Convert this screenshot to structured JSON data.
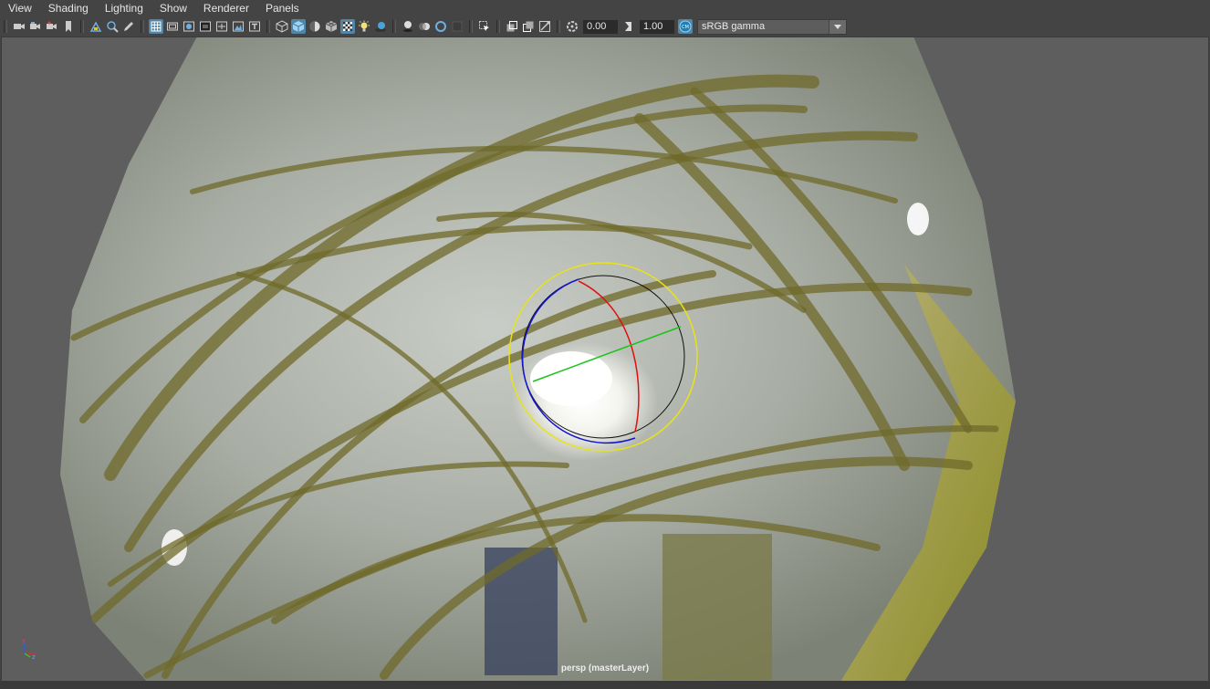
{
  "menu": {
    "items": [
      "View",
      "Shading",
      "Lighting",
      "Show",
      "Renderer",
      "Panels"
    ]
  },
  "toolbar": {
    "exposure_value": "0.00",
    "gamma_value": "1.00",
    "color_management": {
      "selected": "sRGB gamma"
    },
    "icons": [
      "select-camera-icon",
      "camera-attributes-icon",
      "bookmarks-icon",
      "bookmark-icon",
      "image-plane-icon",
      "2d-pan-zoom-icon",
      "grease-pencil-icon",
      "grid-icon",
      "film-gate-icon",
      "resolution-gate-icon",
      "gate-mask-icon",
      "field-chart-icon",
      "safe-action-icon",
      "safe-title-icon",
      "wireframe-icon",
      "smooth-shade-icon",
      "default-lighting-icon",
      "shade-wireframe-icon",
      "textured-icon",
      "use-all-lights-icon",
      "shadows-icon",
      "screen-space-ao-icon",
      "motion-blur-icon",
      "anti-aliasing-icon",
      "depth-of-field-icon",
      "isolate-select-icon",
      "xray-icon",
      "xray-active-icon",
      "xray-joints-icon",
      "exposure-icon",
      "gamma-icon",
      "view-transform-icon"
    ]
  },
  "viewport": {
    "camera_label": "persp (masterLayer)",
    "background_color": "#5e5e5e",
    "axis_labels": {
      "x": "x",
      "y": "y",
      "z": "z"
    },
    "manipulator_colors": {
      "outer_ring": "#e8e21a",
      "x_ring": "#e01010",
      "y_ring": "#19c419",
      "z_ring": "#1414d0",
      "trackball": "#111111"
    }
  },
  "colors": {
    "accent": "#5285a6",
    "panel": "#444444"
  }
}
